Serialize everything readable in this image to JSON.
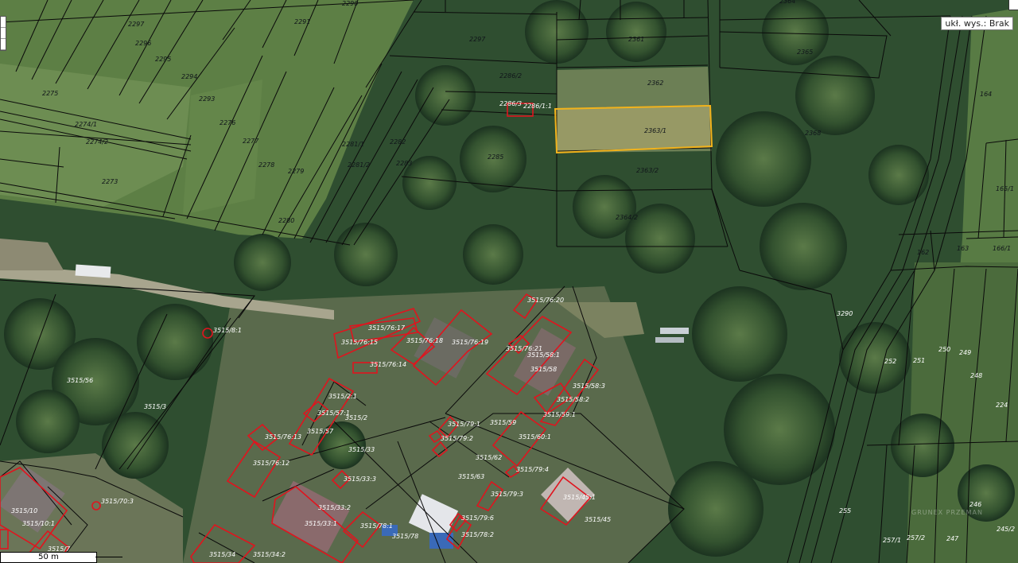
{
  "elevation_label": "ukł. wys.: Brak",
  "scale_label": "50 m",
  "watermark": "GRUNEX PRZEMAN",
  "colors": {
    "parcel_line": "#0a0a0a",
    "building": "#e0141e",
    "selected": "#f2b31c"
  },
  "parcels": {
    "p2297a": "2297",
    "p2296": "2296",
    "p2295": "2295",
    "p2294": "2294",
    "p2293": "2293",
    "p2291": "2291",
    "p2290": "2290",
    "p2275": "2275",
    "p2274_1": "2274/1",
    "p2274_2": "2274/2",
    "p2276": "2276",
    "p2277": "2277",
    "p2278": "2278",
    "p2279": "2279",
    "p2273": "2273",
    "p2280": "2280",
    "p2281_1": "2281/1",
    "p2281_2": "2281/2",
    "p2282": "2282",
    "p2283": "2283",
    "p2297b": "2297",
    "p2286_2": "2286/2",
    "p2286_3": "2286/3",
    "p2286_1_1": "2286/1:1",
    "p2285": "2285",
    "p2361": "2361",
    "p2362": "2362",
    "p2363_1": "2363/1",
    "p2363_2": "2363/2",
    "p2364_2": "2364/2",
    "p2364": "2364",
    "p2365": "2365",
    "p2368": "2368",
    "p164": "164",
    "p165_1": "165/1",
    "p162": "162",
    "p163": "163",
    "p166_1": "166/1",
    "p3290": "3290",
    "p252": "252",
    "p251": "251",
    "p250": "250",
    "p249": "249",
    "p248": "248",
    "p224": "224",
    "p255": "255",
    "p257_1": "257/1",
    "p257_2": "257/2",
    "p247": "247",
    "p246": "246",
    "p245_2": "245/2",
    "p3515_56": "3515/56",
    "p3515_3": "3515/3",
    "p3515_8_1": "3515/8:1",
    "p3515_76_15": "3515/76:15",
    "p3515_76_17": "3515/76:17",
    "p3515_76_14": "3515/76:14",
    "p3515_76_18": "3515/76:18",
    "p3515_76_19": "3515/76:19",
    "p3515_76_20": "3515/76:20",
    "p3515_76_21": "3515/76:21",
    "p3515_58_1": "3515/58:1",
    "p3515_58": "3515/58",
    "p3515_58_3": "3515/58:3",
    "p3515_58_2": "3515/58:2",
    "p3515_59_1": "3515/59:1",
    "p3515_2_1": "3515/2:1",
    "p3515_57_1": "3515/57:1",
    "p3515_57": "3515/57",
    "p3515_2": "3515/2",
    "p3515_76_13": "3515/76:13",
    "p3515_76_12": "3515/76:12",
    "p3515_79_1": "3515/79:1",
    "p3515_79_2": "3515/79:2",
    "p3515_79_3b": "3515/79:3",
    "p3515_59": "3515/59",
    "p3515_60_1": "3515/60:1",
    "p3515_62": "3515/62",
    "p3515_79_4": "3515/79:4",
    "p3515_33": "3515/33",
    "p3515_33_3": "3515/33:3",
    "p3515_63": "3515/63",
    "p3515_79_3": "3515/79:3",
    "p3515_45_1": "3515/45:1",
    "p3515_45": "3515/45",
    "p3515_33_2": "3515/33:2",
    "p3515_33_1": "3515/33:1",
    "p3515_78_1": "3515/78:1",
    "p3515_78": "3515/78",
    "p3515_79_6": "3515/79:6",
    "p3515_78_2": "3515/78:2",
    "p3515_70_3": "3515/70:3",
    "p3515_10": "3515/10",
    "p3515_10_1": "3515/10:1",
    "p3515_7": "3515/7",
    "p3515_34": "3515/34",
    "p3515_34_2": "3515/34:2"
  }
}
